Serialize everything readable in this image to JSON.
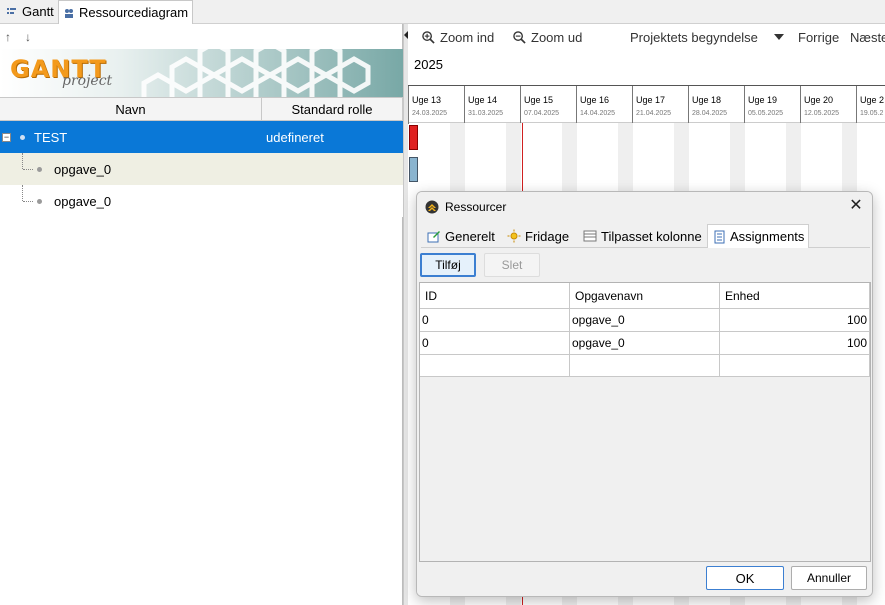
{
  "top_tabs": [
    {
      "label": "Gantt",
      "icon": "gantt-chart-icon"
    },
    {
      "label": "Ressourcediagram",
      "icon": "people-icon"
    }
  ],
  "left": {
    "toolbar": {
      "up": "↑",
      "down": "↓"
    },
    "logo": {
      "main": "GANTT",
      "sub": "project"
    },
    "columns": [
      "Navn",
      "Standard rolle"
    ],
    "rows": [
      {
        "name": "TEST",
        "role": "udefineret",
        "toggle": "−"
      },
      {
        "name": "opgave_0",
        "role": ""
      },
      {
        "name": "opgave_0",
        "role": ""
      }
    ]
  },
  "right": {
    "toolbar": {
      "zoom_in": "Zoom ind",
      "zoom_out": "Zoom ud",
      "project_start": "Projektets begyndelse",
      "previous": "Forrige",
      "next": "Næste"
    },
    "year": "2025",
    "weeks": [
      {
        "label": "Uge 13",
        "date": "24.03.2025"
      },
      {
        "label": "Uge 14",
        "date": "31.03.2025"
      },
      {
        "label": "Uge 15",
        "date": "07.04.2025"
      },
      {
        "label": "Uge 16",
        "date": "14.04.2025"
      },
      {
        "label": "Uge 17",
        "date": "21.04.2025"
      },
      {
        "label": "Uge 18",
        "date": "28.04.2025"
      },
      {
        "label": "Uge 19",
        "date": "05.05.2025"
      },
      {
        "label": "Uge 20",
        "date": "12.05.2025"
      },
      {
        "label": "Uge 2",
        "date": "19.05.2"
      }
    ]
  },
  "dialog": {
    "title": "Ressourcer",
    "close": "✕",
    "tabs": [
      {
        "label": "Generelt",
        "icon": "edit-icon"
      },
      {
        "label": "Fridage",
        "icon": "sun-icon"
      },
      {
        "label": "Tilpasset kolonne",
        "icon": "table-icon"
      },
      {
        "label": "Assignments",
        "icon": "document-icon"
      }
    ],
    "add_label": "Tilføj",
    "delete_label": "Slet",
    "columns": [
      "ID",
      "Opgavenavn",
      "Enhed"
    ],
    "rows": [
      {
        "id": "0",
        "task": "opgave_0",
        "unit": "100"
      },
      {
        "id": "0",
        "task": "opgave_0",
        "unit": "100"
      },
      {
        "id": "",
        "task": "",
        "unit": ""
      }
    ],
    "ok_label": "OK",
    "cancel_label": "Annuller"
  },
  "colors": {
    "selection": "#0a78d7",
    "today_line": "#d02020",
    "task_bar_red": "#e02020",
    "task_bar_blue": "#8ab4cf",
    "logo_orange": "#f39a1c"
  }
}
